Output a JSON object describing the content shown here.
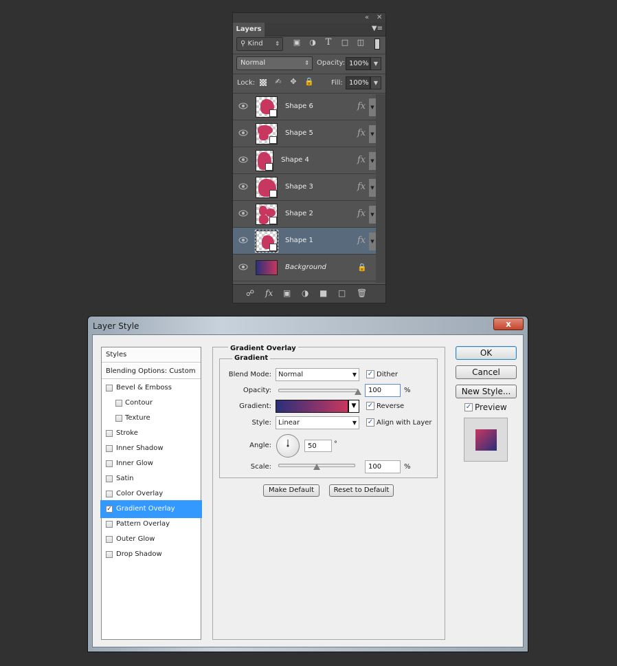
{
  "layers_panel": {
    "collapse_icon": "double-chevron-icon",
    "close_icon": "close-icon",
    "tab": "Layers",
    "filter_kind": "Kind",
    "filter_icons": [
      "image-filter-icon",
      "adjustment-filter-icon",
      "type-filter-icon",
      "shape-filter-icon",
      "smart-object-filter-icon",
      "filter-toggle-icon"
    ],
    "blend_mode": "Normal",
    "opacity_label": "Opacity:",
    "opacity_value": "100%",
    "lock_label": "Lock:",
    "fill_label": "Fill:",
    "fill_value": "100%",
    "layers": [
      {
        "name": "Shape 6",
        "fx": "fx",
        "selected": false
      },
      {
        "name": "Shape 5",
        "fx": "fx",
        "selected": false
      },
      {
        "name": "Shape 4",
        "fx": "fx",
        "selected": false
      },
      {
        "name": "Shape 3",
        "fx": "fx",
        "selected": false
      },
      {
        "name": "Shape 2",
        "fx": "fx",
        "selected": false
      },
      {
        "name": "Shape 1",
        "fx": "fx",
        "selected": true
      },
      {
        "name": "Background",
        "fx": "",
        "selected": false
      }
    ],
    "layer_fill_color": "#c8375f",
    "selected_color": "#5a6a7d",
    "background_gradient": [
      "#2a2f7a",
      "#c8375f"
    ],
    "bottom_fx_label": "fx"
  },
  "dialog": {
    "title": "Layer Style",
    "close_label": "x",
    "styles_header": "Styles",
    "blending_options": "Blending Options: Custom",
    "effects": [
      {
        "label": "Bevel & Emboss",
        "checked": false,
        "indent": false
      },
      {
        "label": "Contour",
        "checked": false,
        "indent": true
      },
      {
        "label": "Texture",
        "checked": false,
        "indent": true
      },
      {
        "label": "Stroke",
        "checked": false,
        "indent": false
      },
      {
        "label": "Inner Shadow",
        "checked": false,
        "indent": false
      },
      {
        "label": "Inner Glow",
        "checked": false,
        "indent": false
      },
      {
        "label": "Satin",
        "checked": false,
        "indent": false
      },
      {
        "label": "Color Overlay",
        "checked": false,
        "indent": false
      },
      {
        "label": "Gradient Overlay",
        "checked": true,
        "indent": false,
        "selected": true
      },
      {
        "label": "Pattern Overlay",
        "checked": false,
        "indent": false
      },
      {
        "label": "Outer Glow",
        "checked": false,
        "indent": false
      },
      {
        "label": "Drop Shadow",
        "checked": false,
        "indent": false
      }
    ],
    "section_title": "Gradient Overlay",
    "subsection_title": "Gradient",
    "blend_mode_label": "Blend Mode:",
    "blend_mode_value": "Normal",
    "dither_label": "Dither",
    "dither_checked": true,
    "opacity_label": "Opacity:",
    "opacity_value": "100",
    "opacity_percent": 100,
    "percent_sign": "%",
    "gradient_label": "Gradient:",
    "gradient_colors": [
      "#2a2f7a",
      "#c8375f"
    ],
    "reverse_label": "Reverse",
    "reverse_checked": true,
    "style_label": "Style:",
    "style_value": "Linear",
    "align_label": "Align with Layer",
    "align_checked": true,
    "angle_label": "Angle:",
    "angle_value": "50",
    "angle_degrees": 50,
    "degree_sign": "°",
    "scale_label": "Scale:",
    "scale_value": "100",
    "scale_fraction": 0.5,
    "make_default": "Make Default",
    "reset_default": "Reset to Default",
    "ok": "OK",
    "cancel": "Cancel",
    "new_style": "New Style...",
    "preview_label": "Preview",
    "preview_checked": true
  }
}
